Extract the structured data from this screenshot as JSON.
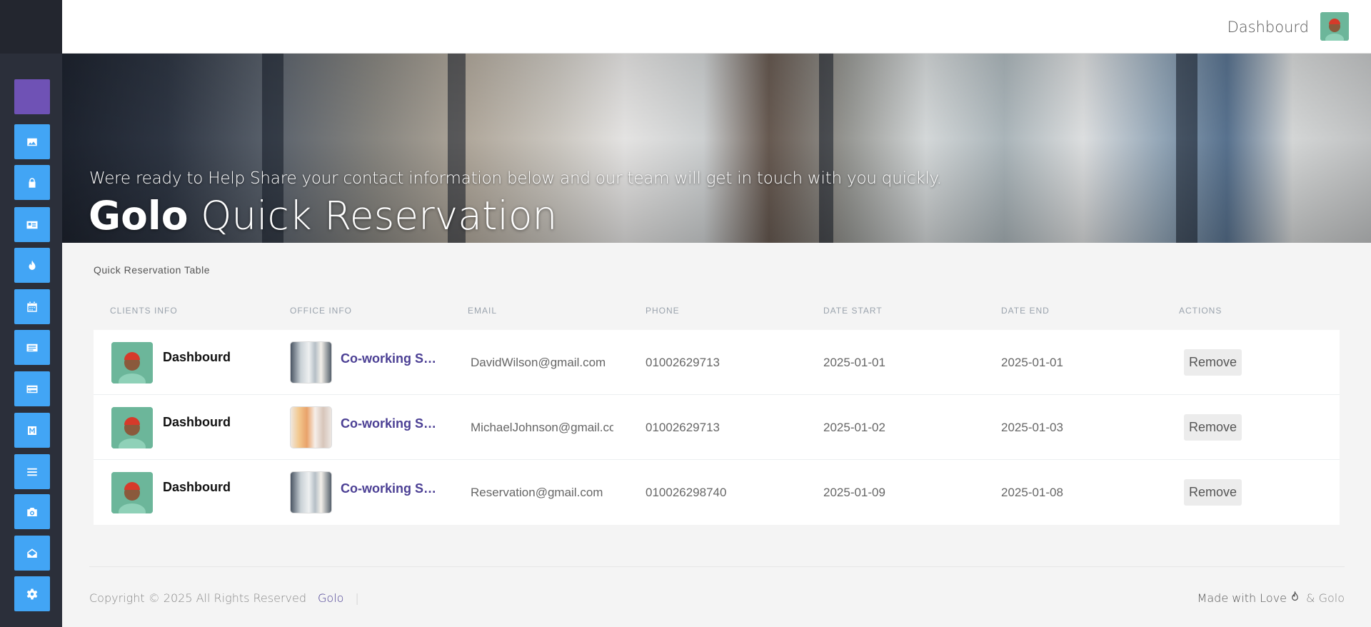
{
  "header": {
    "title": "Dashbourd"
  },
  "sidebar": {
    "items": [
      {
        "icon": "app-logo-icon",
        "color": "#6f52b5"
      },
      {
        "icon": "image-icon",
        "color": "#42a5f5"
      },
      {
        "icon": "lock-icon",
        "color": "#42a5f5"
      },
      {
        "icon": "id-card-icon",
        "color": "#42a5f5"
      },
      {
        "icon": "fire-icon",
        "color": "#42a5f5"
      },
      {
        "icon": "calendar-icon",
        "color": "#42a5f5"
      },
      {
        "icon": "list-card-icon",
        "color": "#42a5f5"
      },
      {
        "icon": "credit-card-icon",
        "color": "#42a5f5"
      },
      {
        "icon": "m-icon",
        "color": "#42a5f5"
      },
      {
        "icon": "menu-icon",
        "color": "#42a5f5"
      },
      {
        "icon": "camera-icon",
        "color": "#42a5f5"
      },
      {
        "icon": "envelope-open-icon",
        "color": "#42a5f5"
      },
      {
        "icon": "gear-icon",
        "color": "#42a5f5"
      }
    ]
  },
  "hero": {
    "subtitle": "Were ready to Help Share your contact information below and our team will get in touch with you quickly.",
    "title_brand": "Golo",
    "title_rest": "Quick Reservation"
  },
  "table": {
    "caption": "Quick Reservation Table",
    "headers": [
      "CLIENTS INFO",
      "OFFICE INFO",
      "EMAIL",
      "PHONE",
      "DATE START",
      "DATE END",
      "ACTIONS"
    ],
    "rows": [
      {
        "client": "Dashbourd",
        "office": "Co-working Space",
        "email": "DavidWilson@gmail.com",
        "phone": "01002629713",
        "start": "2025-01-01",
        "end": "2025-01-01",
        "action": "Remove"
      },
      {
        "client": "Dashbourd",
        "office": "Co-working Space",
        "email": "MichaelJohnson@gmail.com",
        "phone": "01002629713",
        "start": "2025-01-02",
        "end": "2025-01-03",
        "action": "Remove"
      },
      {
        "client": "Dashbourd",
        "office": "Co-working Space",
        "email": "Reservation@gmail.com",
        "phone": "010026298740",
        "start": "2025-01-09",
        "end": "2025-01-08",
        "action": "Remove"
      }
    ]
  },
  "footer": {
    "copyright": "Copyright © 2025 All Rights Reserved",
    "brand": "Golo",
    "separator": "|",
    "made_with": "Made with Love",
    "made_by": "& Golo"
  },
  "colors": {
    "accent": "#4b3f94",
    "sidebar_button": "#42a5f5",
    "sidebar_logo": "#6f52b5",
    "sidebar_bg": "#2b2f3a"
  }
}
